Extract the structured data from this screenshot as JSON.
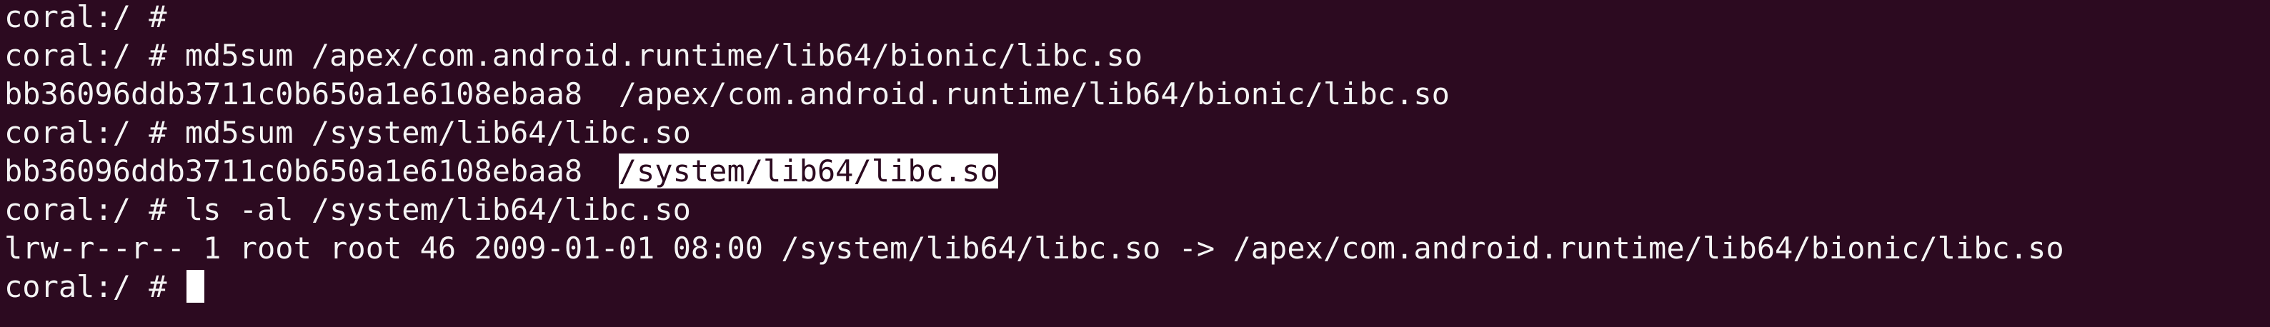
{
  "terminal": {
    "colors": {
      "background": "#2c0a20",
      "foreground": "#f4f4f4",
      "selection_bg": "#ffffff",
      "cursor": "#ffffff"
    },
    "lines": [
      {
        "text": "coral:/ #"
      },
      {
        "text": "coral:/ # md5sum /apex/com.android.runtime/lib64/bionic/libc.so"
      },
      {
        "text": "bb36096ddb3711c0b650a1e6108ebaa8  /apex/com.android.runtime/lib64/bionic/libc.so"
      },
      {
        "text": "coral:/ # md5sum /system/lib64/libc.so"
      },
      {
        "prefix": "bb36096ddb3711c0b650a1e6108ebaa8  ",
        "selected": "/system/lib64/libc.so"
      },
      {
        "text": "coral:/ # ls -al /system/lib64/libc.so"
      },
      {
        "text": "lrw-r--r-- 1 root root 46 2009-01-01 08:00 /system/lib64/libc.so -> /apex/com.android.runtime/lib64/bionic/libc.so"
      },
      {
        "prompt": "coral:/ # "
      }
    ]
  }
}
